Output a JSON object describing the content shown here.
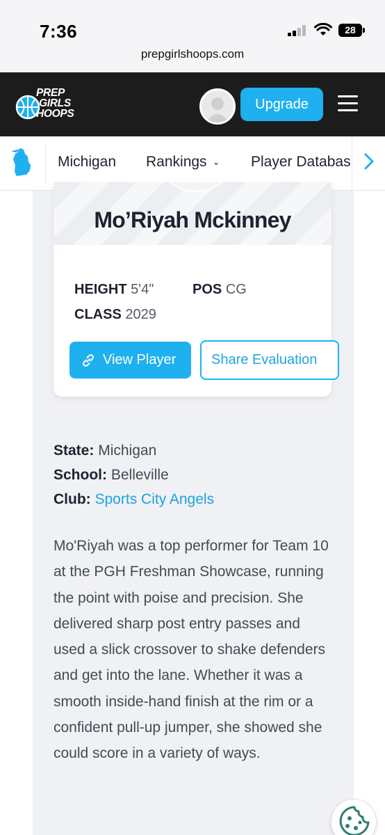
{
  "status_bar": {
    "time": "7:36",
    "battery": "28"
  },
  "browser": {
    "url": "prepgirlshoops.com"
  },
  "header": {
    "logo_lines": [
      "PREP",
      "GIRLS",
      "HOOPS"
    ],
    "upgrade_label": "Upgrade"
  },
  "sub_nav": {
    "items": [
      {
        "label": "Michigan"
      },
      {
        "label": "Rankings"
      },
      {
        "label": "Player Databas"
      }
    ]
  },
  "player": {
    "name": "Mo’Riyah Mckinney",
    "height_label": "HEIGHT",
    "height_value": "5'4\"",
    "pos_label": "POS",
    "pos_value": "CG",
    "class_label": "CLASS",
    "class_value": "2029",
    "view_label": "View Player",
    "share_label": "Share Evaluation"
  },
  "details": {
    "state_label": "State:",
    "state_value": "Michigan",
    "school_label": "School:",
    "school_value": "Belleville",
    "club_label": "Club:",
    "club_value": "Sports City Angels"
  },
  "evaluation": "Mo'Riyah was a top performer for Team 10 at the PGH Freshman Showcase, running the point with poise and precision. She delivered sharp post entry passes and used a slick crossover to shake defenders and get into the lane. Whether it was a smooth inside-hand finish at the rim or a confident pull-up jumper, she showed she could score in a variety of ways.",
  "colors": {
    "accent": "#1fb0f0",
    "header_bg": "#1c1c1c",
    "panel_bg": "#f0f1f4",
    "cookie": "#2e7d6b"
  }
}
